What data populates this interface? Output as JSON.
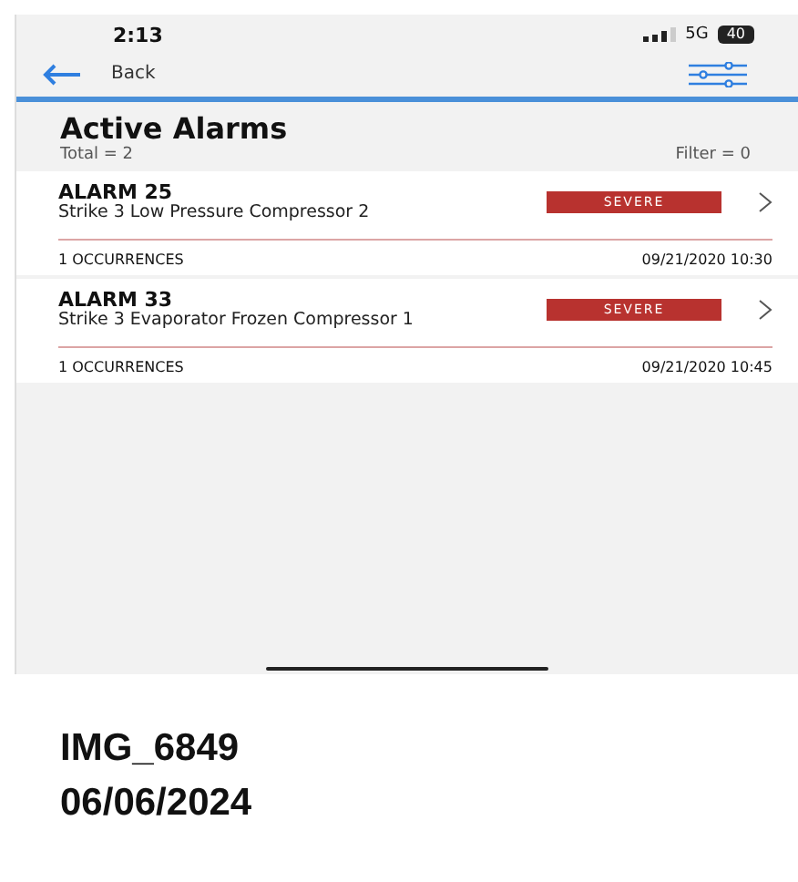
{
  "status_bar": {
    "time": "2:13",
    "network": "5G",
    "battery": "40"
  },
  "nav": {
    "back_label": "Back"
  },
  "header": {
    "title": "Active Alarms",
    "total": "Total = 2",
    "filter": "Filter = 0"
  },
  "alarms": [
    {
      "name": "ALARM 25",
      "description": "Strike 3 Low Pressure Compressor 2",
      "severity": "SEVERE",
      "occurrences": "1 OCCURRENCES",
      "timestamp": "09/21/2020 10:30"
    },
    {
      "name": "ALARM 33",
      "description": "Strike 3 Evaporator Frozen Compressor 1",
      "severity": "SEVERE",
      "occurrences": "1 OCCURRENCES",
      "timestamp": "09/21/2020 10:45"
    }
  ],
  "caption": {
    "filename": "IMG_6849",
    "date": "06/06/2024"
  }
}
